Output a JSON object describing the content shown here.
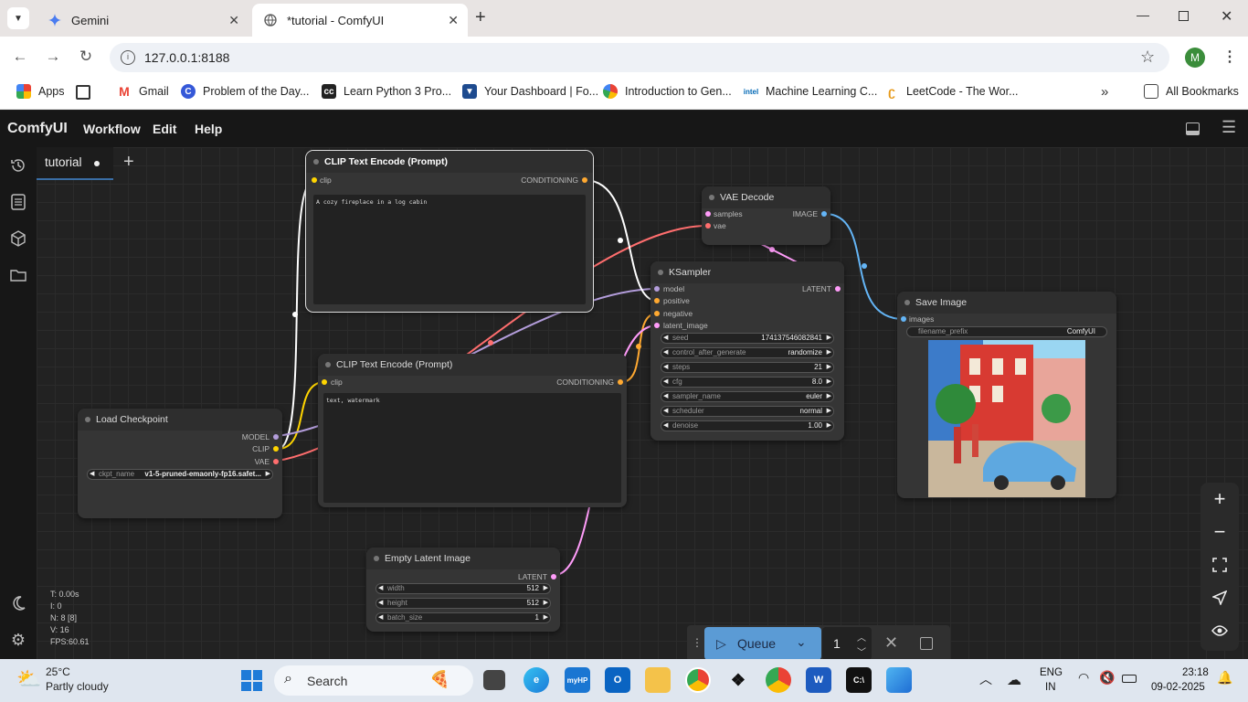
{
  "browser": {
    "tabs": [
      {
        "title": "Gemini",
        "icon": "gemini-icon"
      },
      {
        "title": "*tutorial - ComfyUI",
        "icon": "globe-icon"
      }
    ],
    "url": "127.0.0.1:8188",
    "profile_initial": "M",
    "bookmarks": [
      {
        "label": "Apps"
      },
      {
        "label": "Gmail"
      },
      {
        "label": "Problem of the Day..."
      },
      {
        "label": "Learn Python 3 Pro..."
      },
      {
        "label": "Your Dashboard | Fo..."
      },
      {
        "label": "Introduction to Gen..."
      },
      {
        "label": "Machine Learning C..."
      },
      {
        "label": "LeetCode - The Wor..."
      }
    ],
    "all_bookmarks": "All Bookmarks"
  },
  "comfy": {
    "logo": "ComfyUI",
    "menus": [
      "Workflow",
      "Edit",
      "Help"
    ],
    "workflow_tab": "tutorial",
    "nodes": {
      "clip_pos": {
        "title": "CLIP Text Encode (Prompt)",
        "in_clip": "clip",
        "out": "CONDITIONING",
        "text": "A cozy fireplace in a log cabin"
      },
      "clip_neg": {
        "title": "CLIP Text Encode (Prompt)",
        "in_clip": "clip",
        "out": "CONDITIONING",
        "text": "text, watermark"
      },
      "vae_decode": {
        "title": "VAE Decode",
        "in_samples": "samples",
        "in_vae": "vae",
        "out": "IMAGE"
      },
      "ksampler": {
        "title": "KSampler",
        "inputs": [
          "model",
          "positive",
          "negative",
          "latent_image"
        ],
        "out": "LATENT",
        "widgets": [
          {
            "label": "seed",
            "value": "174137546082841"
          },
          {
            "label": "control_after_generate",
            "value": "randomize"
          },
          {
            "label": "steps",
            "value": "21"
          },
          {
            "label": "cfg",
            "value": "8.0"
          },
          {
            "label": "sampler_name",
            "value": "euler"
          },
          {
            "label": "scheduler",
            "value": "normal"
          },
          {
            "label": "denoise",
            "value": "1.00"
          }
        ]
      },
      "save_image": {
        "title": "Save Image",
        "in_images": "images",
        "prefix_label": "filename_prefix",
        "prefix_value": "ComfyUI"
      },
      "load_checkpoint": {
        "title": "Load Checkpoint",
        "outs": [
          "MODEL",
          "CLIP",
          "VAE"
        ],
        "ckpt_label": "ckpt_name",
        "ckpt_value": "v1-5-pruned-emaonly-fp16.safet..."
      },
      "empty_latent": {
        "title": "Empty Latent Image",
        "out": "LATENT",
        "widgets": [
          {
            "label": "width",
            "value": "512"
          },
          {
            "label": "height",
            "value": "512"
          },
          {
            "label": "batch_size",
            "value": "1"
          }
        ]
      }
    },
    "stats": [
      "T: 0.00s",
      "I: 0",
      "N: 8 [8]",
      "V: 16",
      "FPS:60.61"
    ],
    "queue": {
      "label": "Queue",
      "count": "1"
    }
  },
  "taskbar": {
    "weather_temp": "25°C",
    "weather_text": "Partly cloudy",
    "search_placeholder": "Search",
    "lang1": "ENG",
    "lang2": "IN",
    "time": "23:18",
    "date": "09-02-2025"
  },
  "colors": {
    "clip_yellow": "#ffd500",
    "model_purple": "#b39ddb",
    "vae_red": "#ff6e6e",
    "latent_pink": "#ff9cf9",
    "image_blue": "#64b5f6",
    "cond_orange": "#ffa931"
  }
}
